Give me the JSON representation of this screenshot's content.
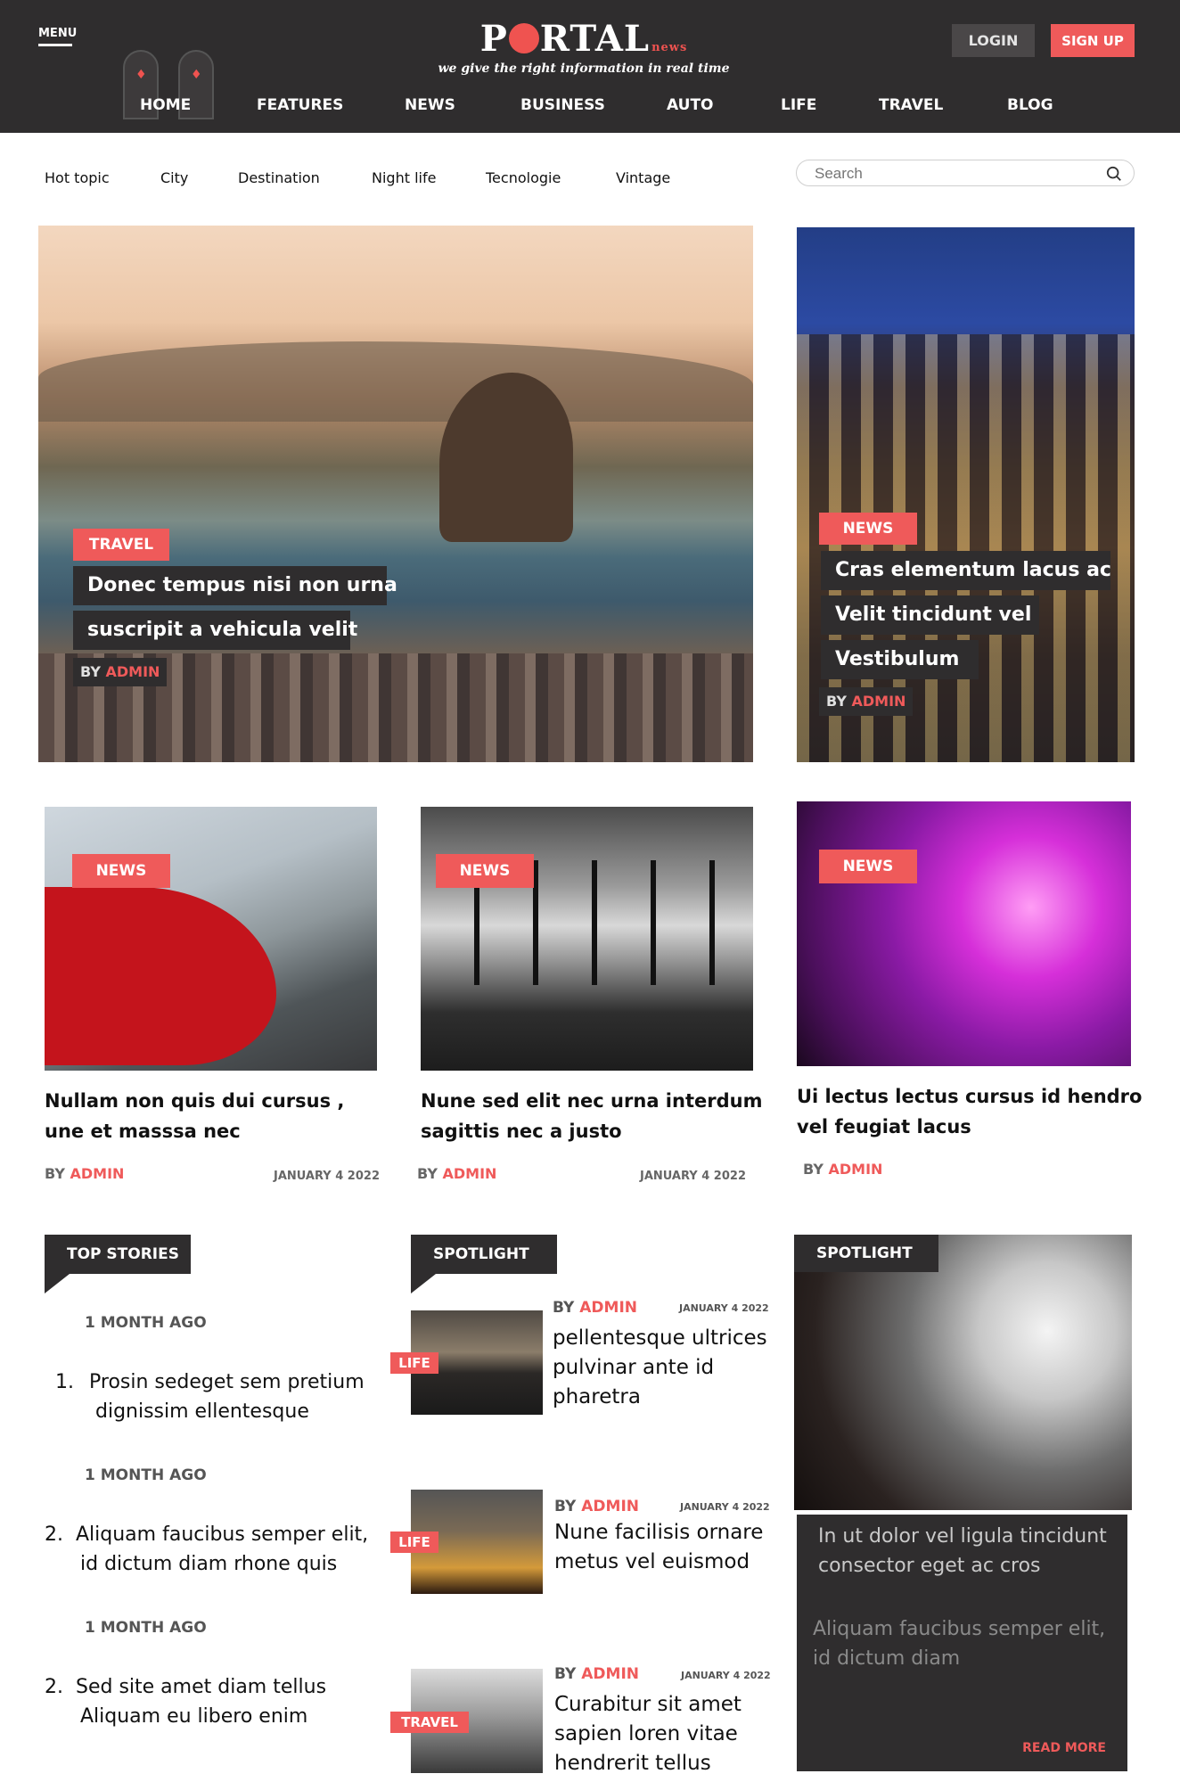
{
  "header": {
    "menu_label": "MENU",
    "logo": {
      "p": "P",
      "rtal": "RTAL",
      "small": "news",
      "tagline": "we give the right information in real time"
    },
    "login": "LOGIN",
    "signup": "SIGN UP",
    "nav": [
      "HOME",
      "FEATURES",
      "NEWS",
      "BUSINESS",
      "AUTO",
      "LIFE",
      "TRAVEL",
      "BLOG"
    ],
    "colors": {
      "bar": "#2f2d2e",
      "accent": "#ef5a5a"
    }
  },
  "subnav": {
    "items": [
      "Hot topic",
      "City",
      "Destination",
      "Night life",
      "Tecnologie",
      "Vintage"
    ],
    "search_placeholder": "Search",
    "search_icon": "search-icon"
  },
  "hero": {
    "left": {
      "tag": "TRAVEL",
      "lines": [
        "Donec tempus nisi non urna",
        "suscripit a vehicula velit"
      ],
      "by": "BY",
      "author": "ADMIN"
    },
    "right": {
      "tag": "NEWS",
      "lines": [
        "Cras elementum lacus ac",
        "Velit tincidunt vel",
        "Vestibulum"
      ],
      "by": "BY",
      "author": "ADMIN"
    }
  },
  "cards": [
    {
      "tag": "NEWS",
      "title_lines": [
        "Nullam non quis dui cursus ,",
        "une et masssa nec"
      ],
      "by": "BY",
      "author": "ADMIN",
      "date": "JANUARY 4 2022"
    },
    {
      "tag": "NEWS",
      "title_lines": [
        "Nune sed elit nec urna interdum",
        "sagittis nec a justo"
      ],
      "by": "BY",
      "author": "ADMIN",
      "date": "JANUARY 4 2022"
    },
    {
      "tag": "NEWS",
      "title_lines": [
        "Ui lectus lectus cursus id hendro",
        "vel feugiat lacus"
      ],
      "by": "BY",
      "author": "ADMIN"
    }
  ],
  "top_stories": {
    "label": "TOP STORIES",
    "items": [
      {
        "ago": "1 MONTH AGO",
        "num": "1.",
        "lines": [
          "Prosin sedeget sem pretium",
          "dignissim ellentesque"
        ]
      },
      {
        "ago": "1 MONTH AGO",
        "num": "2.",
        "lines": [
          "Aliquam faucibus semper elit,",
          "id dictum diam rhone quis"
        ]
      },
      {
        "ago": "1 MONTH AGO",
        "num": "2.",
        "lines": [
          "Sed site amet diam tellus",
          "Aliquam eu libero enim"
        ]
      }
    ]
  },
  "spotlight": {
    "label": "SPOTLIGHT",
    "items": [
      {
        "tag": "LIFE",
        "by": "BY",
        "author": "ADMIN",
        "date": "JANUARY 4 2022",
        "lines": [
          "pellentesque ultrices",
          "pulvinar ante id",
          "pharetra"
        ]
      },
      {
        "tag": "LIFE",
        "by": "BY",
        "author": "ADMIN",
        "date": "JANUARY 4 2022",
        "lines": [
          "Nune facilisis ornare",
          "metus vel euismod"
        ]
      },
      {
        "tag": "TRAVEL",
        "by": "BY",
        "author": "ADMIN",
        "date": "JANUARY 4 2022",
        "lines": [
          "Curabitur sit amet",
          "sapien loren vitae",
          "hendrerit tellus"
        ]
      }
    ]
  },
  "spotlight_right": {
    "label": "SPOTLIGHT",
    "quote_1": "In ut dolor vel ligula tincidunt consector eget ac cros",
    "quote_2": "Aliquam faucibus semper elit, id dictum diam",
    "read_more": "READ MORE"
  }
}
